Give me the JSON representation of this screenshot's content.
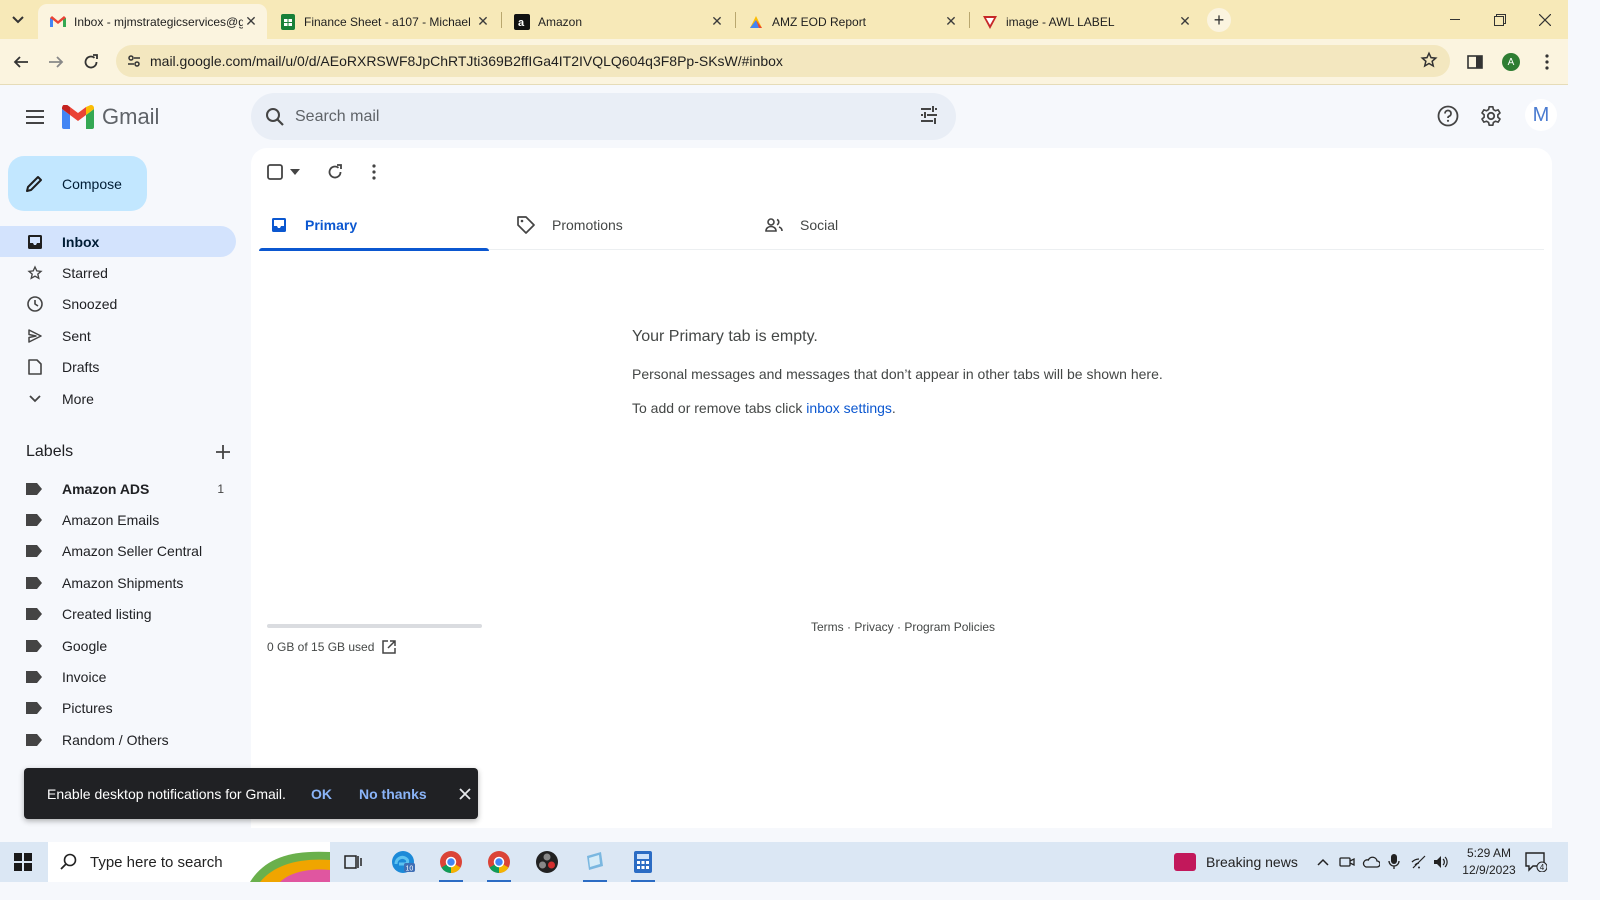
{
  "browser": {
    "tabs": [
      {
        "title": "Inbox - mjmstrategicservices@g",
        "favicon": "gmail-icon",
        "active": true
      },
      {
        "title": "Finance Sheet - a107 - Michael",
        "favicon": "sheets-icon",
        "active": false
      },
      {
        "title": "Amazon",
        "favicon": "amazon-icon",
        "active": false
      },
      {
        "title": "AMZ EOD Report",
        "favicon": "report-icon",
        "active": false
      },
      {
        "title": "image - AWL LABEL",
        "favicon": "awl-icon",
        "active": false
      }
    ],
    "url": "mail.google.com/mail/u/0/d/AEoRXRSWF8JpChRTJti369B2ffIGa4IT2IVQLQ604q3F8Pp-SKsW/#inbox",
    "profile_initial": "A",
    "close_glyph": "✕"
  },
  "gmail": {
    "logo_text": "Gmail",
    "search_placeholder": "Search mail",
    "account_initial": "M",
    "compose_label": "Compose",
    "nav": [
      {
        "label": "Inbox",
        "icon": "inbox-icon",
        "active": true
      },
      {
        "label": "Starred",
        "icon": "star-icon",
        "active": false
      },
      {
        "label": "Snoozed",
        "icon": "clock-icon",
        "active": false
      },
      {
        "label": "Sent",
        "icon": "send-icon",
        "active": false
      },
      {
        "label": "Drafts",
        "icon": "draft-icon",
        "active": false
      },
      {
        "label": "More",
        "icon": "chevron-down-icon",
        "active": false
      }
    ],
    "labels_heading": "Labels",
    "labels": [
      {
        "name": "Amazon ADS",
        "count": "1",
        "bold": true
      },
      {
        "name": "Amazon Emails",
        "count": "",
        "bold": false
      },
      {
        "name": "Amazon Seller Central",
        "count": "",
        "bold": false
      },
      {
        "name": "Amazon Shipments",
        "count": "",
        "bold": false
      },
      {
        "name": "Created listing",
        "count": "",
        "bold": false
      },
      {
        "name": "Google",
        "count": "",
        "bold": false
      },
      {
        "name": "Invoice",
        "count": "",
        "bold": false
      },
      {
        "name": "Pictures",
        "count": "",
        "bold": false
      },
      {
        "name": "Random / Others",
        "count": "",
        "bold": false
      }
    ],
    "category_tabs": [
      {
        "label": "Primary",
        "icon": "inbox-tab-icon",
        "active": true
      },
      {
        "label": "Promotions",
        "icon": "tag-icon",
        "active": false
      },
      {
        "label": "Social",
        "icon": "people-icon",
        "active": false
      }
    ],
    "empty": {
      "title": "Your Primary tab is empty.",
      "line1": "Personal messages and messages that don’t appear in other tabs will be shown here.",
      "line2_prefix": "To add or remove tabs click ",
      "line2_link": "inbox settings",
      "line2_suffix": "."
    },
    "storage": {
      "text": "0 GB of 15 GB used",
      "fraction": 0.0
    },
    "footer": {
      "terms": "Terms",
      "privacy": "Privacy",
      "policies": "Program Policies",
      "sep": " · "
    },
    "toast": {
      "message": "Enable desktop notifications for Gmail.",
      "ok": "OK",
      "no_thanks": "No thanks"
    },
    "colors": {
      "accent": "#0b57d0",
      "compose_bg": "#c2e7ff",
      "active_nav": "#d3e3fd"
    }
  },
  "taskbar": {
    "search_placeholder": "Type here to search",
    "news": "Breaking news",
    "time": "5:29 AM",
    "date": "12/9/2023",
    "notification_count": "4",
    "edge_badge": "10"
  }
}
